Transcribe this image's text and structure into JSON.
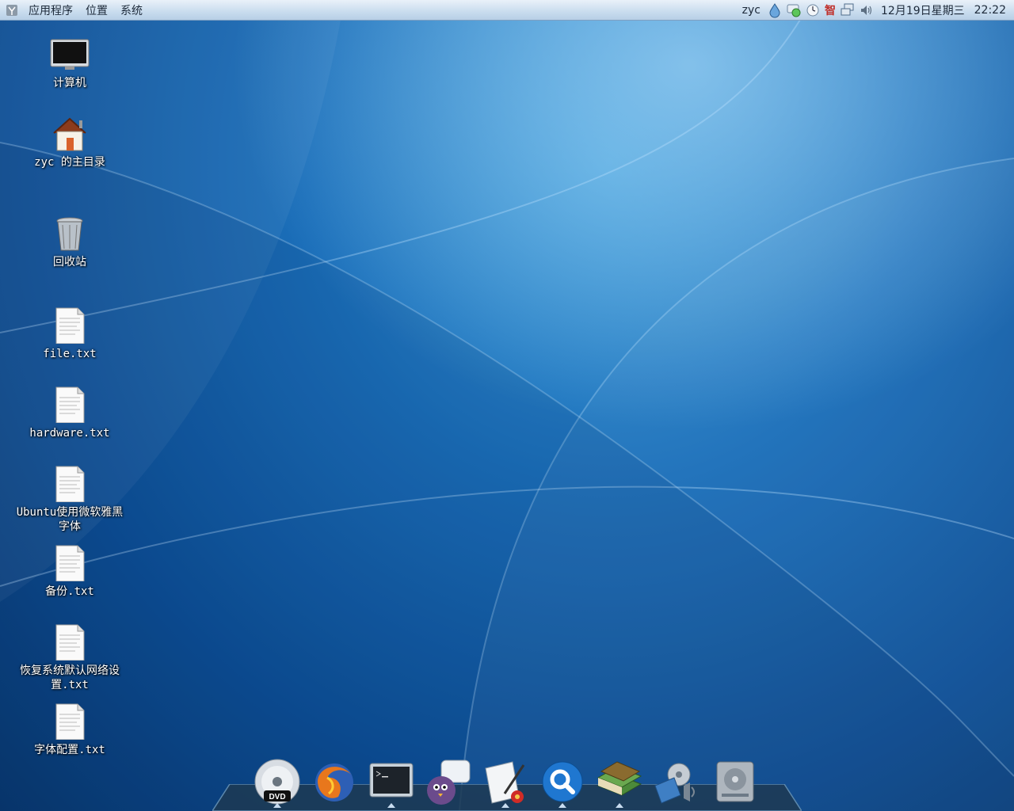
{
  "panel": {
    "menus": [
      "应用程序",
      "位置",
      "系统"
    ],
    "user": "zyc",
    "ime_label": "智",
    "date": "12月19日星期三",
    "time": "22:22"
  },
  "desktop": {
    "icons": [
      {
        "label": "计算机",
        "icon": "computer-icon"
      },
      {
        "label": "zyc 的主目录",
        "icon": "home-folder-icon"
      },
      {
        "label": "回收站",
        "icon": "trash-icon"
      },
      {
        "label": "file.txt",
        "icon": "text-file-icon"
      },
      {
        "label": "hardware.txt",
        "icon": "text-file-icon"
      },
      {
        "label": "Ubuntu使用微软雅黑字体",
        "icon": "text-file-icon"
      },
      {
        "label": "备份.txt",
        "icon": "text-file-icon"
      },
      {
        "label": "恢复系统默认网络设置.txt",
        "icon": "text-file-icon"
      },
      {
        "label": "字体配置.txt",
        "icon": "text-file-icon"
      }
    ]
  },
  "dock": {
    "items": [
      {
        "icon": "dvd-icon",
        "running": true
      },
      {
        "icon": "browser-icon",
        "running": false
      },
      {
        "icon": "terminal-icon",
        "running": true
      },
      {
        "icon": "chat-pidgin-icon",
        "running": false
      },
      {
        "icon": "text-editor-icon",
        "running": true
      },
      {
        "icon": "search-icon",
        "running": true
      },
      {
        "icon": "books-icon",
        "running": true
      },
      {
        "icon": "media-player-icon",
        "running": false
      },
      {
        "icon": "hard-drive-icon",
        "running": false
      }
    ]
  },
  "colors": {
    "desktop_dark": "#08386f",
    "desktop_light": "#3a9ad8",
    "panel_top": "#e9f1f9",
    "panel_bottom": "#b7cfe6",
    "dock": "#1d3a52"
  }
}
